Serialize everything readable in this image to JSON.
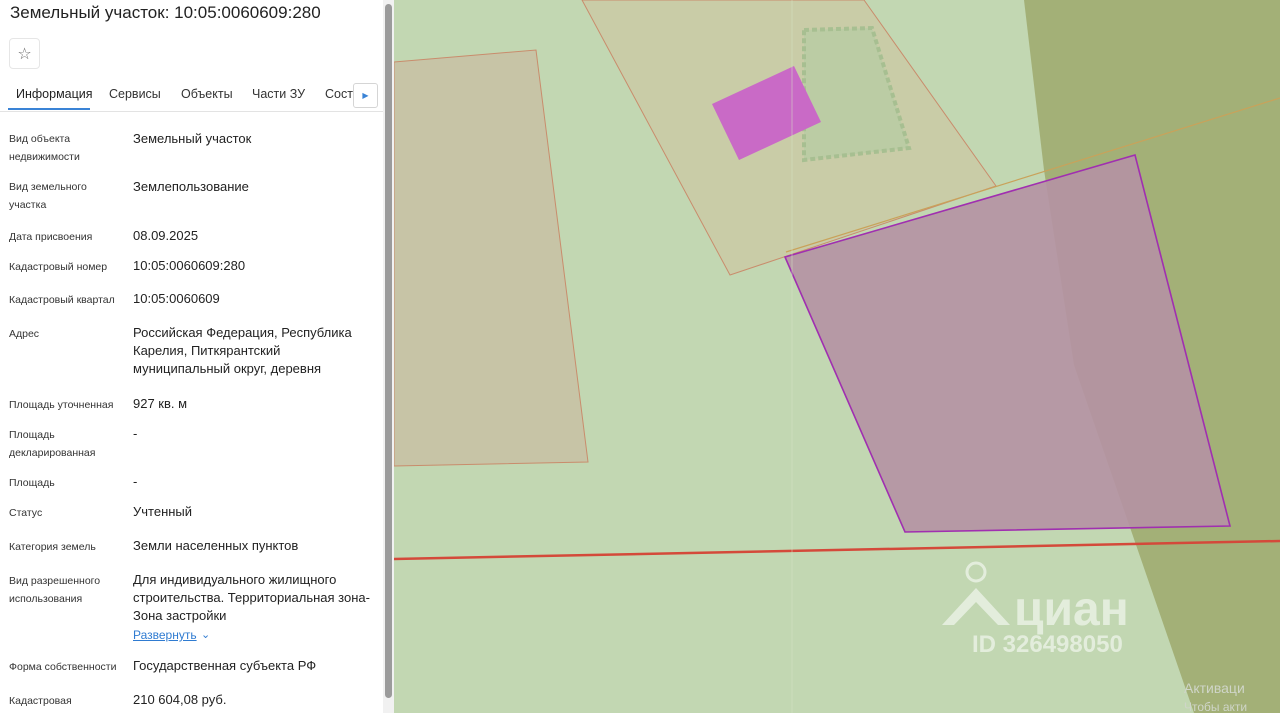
{
  "panel": {
    "title": "Земельный участок: 10:05:0060609:280",
    "favorite_icon": "star-icon",
    "tabs": [
      "Информация",
      "Сервисы",
      "Объекты",
      "Части ЗУ",
      "Соста"
    ],
    "active_tab": "Информация",
    "tabs_next_icon": "arrow-right-icon",
    "rows": [
      {
        "label": "Вид объекта недвижимости",
        "value": "Земельный участок"
      },
      {
        "label": "Вид земельного участка",
        "value": "Землепользование"
      },
      {
        "label": "Дата присвоения",
        "value": "08.09.2025"
      },
      {
        "label": "Кадастровый номер",
        "value": "10:05:0060609:280"
      },
      {
        "label": "Кадастровый квартал",
        "value": "10:05:0060609"
      },
      {
        "label": "Адрес",
        "value": "Российская Федерация, Республика Карелия, Питкярантский муниципальный округ, деревня"
      },
      {
        "label": "Площадь уточненная",
        "value": "927 кв. м"
      },
      {
        "label": "Площадь декларированная",
        "value": "-"
      },
      {
        "label": "Площадь",
        "value": "-"
      },
      {
        "label": "Статус",
        "value": "Учтенный"
      },
      {
        "label": "Категория земель",
        "value": "Земли населенных пунктов"
      },
      {
        "label": "Вид разрешенного использования",
        "value": "Для индивидуального жилищного строительства. Территориальная зона- Зона застройки"
      },
      {
        "label": "Форма собственности",
        "value": "Государственная субъекта РФ"
      },
      {
        "label": "Кадастровая",
        "value": "210 604,08 руб."
      }
    ],
    "expand_label": "Развернуть"
  },
  "map": {
    "watermark_brand": "циан",
    "watermark_id": "ID 326498050",
    "corner_text_1": "Активаци",
    "corner_text_2": "Чтобы акти",
    "colors": {
      "background": "#c2d7b2",
      "olive_zone": "#a3b077",
      "selected_parcel_fill": "#b592a3",
      "selected_parcel_stroke": "#a02fb0",
      "building_fill": "#c96ac6",
      "boundary_line": "#d4493a"
    }
  }
}
